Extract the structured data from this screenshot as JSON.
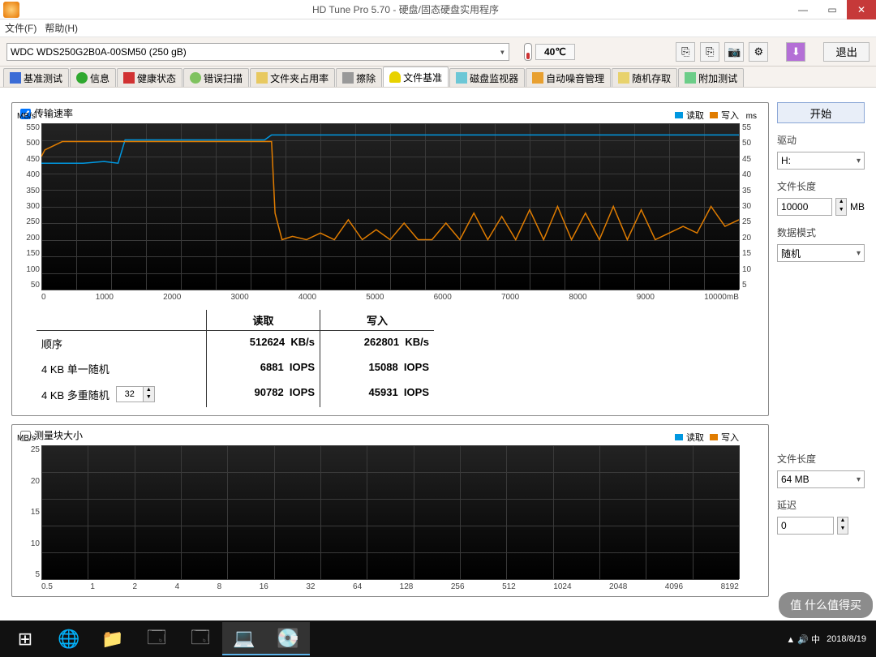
{
  "window": {
    "title": "HD Tune Pro 5.70 - 硬盘/固态硬盘实用程序"
  },
  "menu": {
    "file": "文件(F)",
    "help": "帮助(H)"
  },
  "toolbar": {
    "drive": "WDC WDS250G2B0A-00SM50 (250 gB)",
    "temp": "40℃",
    "exit": "退出"
  },
  "tabs": {
    "benchmark": "基准测试",
    "info": "信息",
    "health": "健康状态",
    "error": "错误扫描",
    "folder": "文件夹占用率",
    "erase": "擦除",
    "file": "文件基准",
    "monitor": "磁盘监视器",
    "aam": "自动噪音管理",
    "random": "随机存取",
    "extra": "附加测试"
  },
  "chart1": {
    "checkbox": "传输速率",
    "yunit": "MB/s",
    "yunit2": "ms",
    "yticks": [
      "550",
      "500",
      "450",
      "400",
      "350",
      "300",
      "250",
      "200",
      "150",
      "100",
      "50"
    ],
    "y2ticks": [
      "55",
      "50",
      "45",
      "40",
      "35",
      "30",
      "25",
      "20",
      "15",
      "10",
      "5"
    ],
    "xticks": [
      "0",
      "1000",
      "2000",
      "3000",
      "4000",
      "5000",
      "6000",
      "7000",
      "8000",
      "9000",
      "10000mB"
    ],
    "legend_read": "读取",
    "legend_write": "写入"
  },
  "results": {
    "hread": "读取",
    "hwrite": "写入",
    "seq": "顺序",
    "r4s": "4 KB 单一随机",
    "r4m": "4 KB 多重随机",
    "spin": "32",
    "seq_r": "512624",
    "seq_w": "262801",
    "u_kbs": "KB/s",
    "r4s_r": "6881",
    "r4s_w": "15088",
    "u_iops": "IOPS",
    "r4m_r": "90782",
    "r4m_w": "45931"
  },
  "chart2": {
    "checkbox": "测量块大小",
    "yunit": "MB/s",
    "yticks": [
      "25",
      "20",
      "15",
      "10",
      "5"
    ],
    "xticks": [
      "0.5",
      "1",
      "2",
      "4",
      "8",
      "16",
      "32",
      "64",
      "128",
      "256",
      "512",
      "1024",
      "2048",
      "4096",
      "8192"
    ]
  },
  "side": {
    "start": "开始",
    "drive_lbl": "驱动",
    "drive": "H:",
    "flen_lbl": "文件长度",
    "flen": "10000",
    "mb": "MB",
    "pattern_lbl": "数据模式",
    "pattern": "随机",
    "flen2_lbl": "文件长度",
    "flen2": "64 MB",
    "delay_lbl": "延迟",
    "delay": "0"
  },
  "taskbar": {
    "date": "2018/8/19"
  },
  "watermark": "值     什么值得买",
  "chart_data": {
    "type": "line",
    "title": "传输速率",
    "xlabel": "mB",
    "ylabel": "MB/s",
    "y2label": "ms",
    "x_range": [
      0,
      10000
    ],
    "y_range": [
      50,
      550
    ],
    "y2_range": [
      5,
      55
    ],
    "series": [
      {
        "name": "读取 (MB/s)",
        "axis": "y",
        "color": "#0097e0",
        "values": [
          [
            0,
            430
          ],
          [
            100,
            430
          ],
          [
            200,
            430
          ],
          [
            300,
            430
          ],
          [
            600,
            430
          ],
          [
            900,
            435
          ],
          [
            1100,
            430
          ],
          [
            1200,
            500
          ],
          [
            1300,
            500
          ],
          [
            2000,
            500
          ],
          [
            3000,
            500
          ],
          [
            3200,
            500
          ],
          [
            3300,
            515
          ],
          [
            4000,
            515
          ],
          [
            6000,
            515
          ],
          [
            8000,
            515
          ],
          [
            10000,
            515
          ]
        ]
      },
      {
        "name": "写入 (MB/s)",
        "axis": "y",
        "color": "#e07c00",
        "values": [
          [
            0,
            450
          ],
          [
            50,
            470
          ],
          [
            300,
            495
          ],
          [
            1000,
            495
          ],
          [
            2000,
            495
          ],
          [
            3000,
            495
          ],
          [
            3300,
            495
          ],
          [
            3350,
            280
          ],
          [
            3450,
            200
          ],
          [
            3600,
            210
          ],
          [
            3800,
            200
          ],
          [
            4000,
            220
          ],
          [
            4200,
            200
          ],
          [
            4400,
            260
          ],
          [
            4600,
            200
          ],
          [
            4800,
            230
          ],
          [
            5000,
            200
          ],
          [
            5200,
            250
          ],
          [
            5400,
            200
          ],
          [
            5600,
            200
          ],
          [
            5800,
            250
          ],
          [
            6000,
            200
          ],
          [
            6200,
            280
          ],
          [
            6400,
            200
          ],
          [
            6600,
            270
          ],
          [
            6800,
            200
          ],
          [
            7000,
            290
          ],
          [
            7200,
            200
          ],
          [
            7400,
            300
          ],
          [
            7600,
            200
          ],
          [
            7800,
            280
          ],
          [
            8000,
            200
          ],
          [
            8200,
            300
          ],
          [
            8400,
            200
          ],
          [
            8600,
            290
          ],
          [
            8800,
            200
          ],
          [
            9000,
            220
          ],
          [
            9200,
            240
          ],
          [
            9400,
            220
          ],
          [
            9600,
            300
          ],
          [
            9800,
            240
          ],
          [
            10000,
            260
          ]
        ]
      }
    ]
  }
}
